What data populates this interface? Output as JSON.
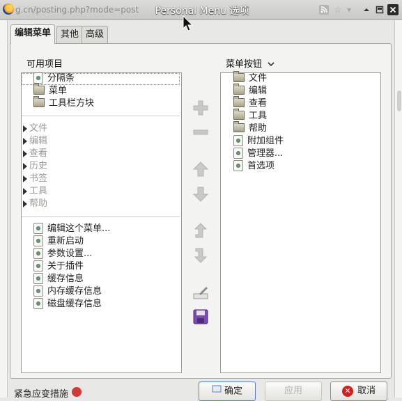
{
  "window": {
    "url_fragment": "g.cn/posting.php?mode=post",
    "title": "Personal Menu 选项",
    "controls": [
      "up",
      "restore",
      "close"
    ]
  },
  "tabs": [
    {
      "label": "编辑菜单",
      "active": true
    },
    {
      "label": "其他",
      "active": false
    },
    {
      "label": "高级",
      "active": false
    }
  ],
  "available": {
    "header": "可用项目",
    "group1": [
      {
        "label": "分隔条",
        "icon": "separator-icon"
      },
      {
        "label": "菜单",
        "icon": "folder-icon"
      },
      {
        "label": "工具栏方块",
        "icon": "folder-icon"
      }
    ],
    "group2": [
      "文件",
      "编辑",
      "查看",
      "历史",
      "书签",
      "工具",
      "帮助"
    ],
    "group3": [
      "编辑这个菜单...",
      "重新启动",
      "参数设置...",
      "关于插件",
      "缓存信息",
      "内存缓存信息",
      "磁盘缓存信息"
    ]
  },
  "menu": {
    "header": "菜单按钮",
    "dropdown_icon": "chevron-down-icon",
    "items": [
      {
        "label": "文件",
        "icon": "folder-icon"
      },
      {
        "label": "编辑",
        "icon": "folder-icon"
      },
      {
        "label": "查看",
        "icon": "folder-icon"
      },
      {
        "label": "工具",
        "icon": "folder-icon"
      },
      {
        "label": "帮助",
        "icon": "folder-icon"
      },
      {
        "label": "附加组件",
        "icon": "separator-icon"
      },
      {
        "label": "管理器...",
        "icon": "separator-icon"
      },
      {
        "label": "首选项",
        "icon": "separator-icon"
      }
    ]
  },
  "middle_buttons": [
    "add-icon",
    "remove-icon",
    "move-up-icon",
    "move-down-icon",
    "move-into-icon",
    "move-out-icon",
    "rename-icon",
    "save-icon"
  ],
  "footer": {
    "left_label": "紧急应变措施",
    "ok": "确定",
    "apply": "应用",
    "cancel": "取消"
  },
  "colors": {
    "accent": "#5b7fb8",
    "close": "#d01f1f",
    "save": "#6b3fa0"
  }
}
